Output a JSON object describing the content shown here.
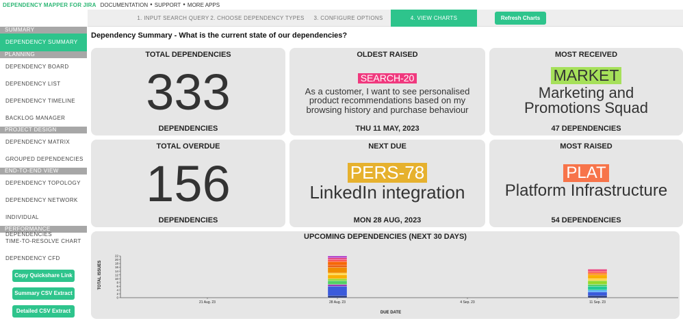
{
  "topbar": {
    "brand": "DEPENDENCY MAPPER FOR JIRA",
    "links": [
      "DOCUMENTATION",
      "SUPPORT",
      "MORE APPS"
    ]
  },
  "steps": [
    {
      "label": "1. INPUT SEARCH QUERY",
      "active": false
    },
    {
      "label": "2. CHOOSE DEPENDENCY TYPES",
      "active": false
    },
    {
      "label": "3. CONFIGURE OPTIONS",
      "active": false
    },
    {
      "label": "4. VIEW CHARTS",
      "active": true
    }
  ],
  "refresh_label": "Refresh Charts",
  "sidebar": {
    "sections": [
      {
        "title": "SUMMARY",
        "items": [
          "DEPENDENCY SUMMARY"
        ]
      },
      {
        "title": "PLANNING",
        "items": [
          "DEPENDENCY BOARD",
          "DEPENDENCY LIST",
          "DEPENDENCY TIMELINE",
          "BACKLOG MANAGER"
        ]
      },
      {
        "title": "PROJECT DESIGN",
        "items": [
          "DEPENDENCY MATRIX",
          "GROUPED DEPENDENCIES"
        ]
      },
      {
        "title": "END-TO-END VIEW",
        "items": [
          "DEPENDENCY TOPOLOGY",
          "DEPENDENCY NETWORK",
          "INDIVIDUAL DEPENDENCIES"
        ]
      },
      {
        "title": "PERFORMANCE",
        "items": [
          "TIME-TO-RESOLVE CHART",
          "DEPENDENCY CFD"
        ]
      }
    ],
    "active_item": "DEPENDENCY SUMMARY",
    "buttons": [
      "Copy Quickshare Link",
      "Summary CSV Extract",
      "Detailed CSV Extract"
    ]
  },
  "heading": "Dependency Summary - What is the current state of our dependencies?",
  "cards": {
    "total": {
      "title": "TOTAL DEPENDENCIES",
      "value": "333",
      "foot": "DEPENDENCIES"
    },
    "oldest": {
      "title": "OLDEST RAISED",
      "key": "SEARCH-20",
      "key_color": "#f0397e",
      "text": "As a customer, I want to see personalised product recommendations based on my browsing history and purchase behaviour",
      "foot": "THU 11 MAY, 2023"
    },
    "received": {
      "title": "MOST RECEIVED",
      "key": "MARKET",
      "key_color": "#a6e05a",
      "text": "Marketing and Promotions Squad",
      "foot": "47 DEPENDENCIES"
    },
    "overdue": {
      "title": "TOTAL OVERDUE",
      "value": "156",
      "foot": "DEPENDENCIES"
    },
    "next": {
      "title": "NEXT DUE",
      "key": "PERS-78",
      "key_color": "#e6b12e",
      "text": "LinkedIn integration",
      "foot": "MON 28 AUG, 2023"
    },
    "raised": {
      "title": "MOST RAISED",
      "key": "PLAT",
      "key_color": "#f7744a",
      "text": "Platform Infrastructure",
      "foot": "54 DEPENDENCIES"
    }
  },
  "chart_data": {
    "type": "bar",
    "title": "UPCOMING DEPENDENCIES (NEXT 30 DAYS)",
    "xlabel": "DUE DATE",
    "ylabel": "TOTAL ISSUES",
    "ylim": [
      0,
      22
    ],
    "yticks": [
      0,
      2,
      4,
      6,
      8,
      10,
      12,
      14,
      16,
      18,
      20,
      22
    ],
    "xticks": [
      "21 Aug. 23",
      "28 Aug. 23",
      "4 Sep. 23",
      "11 Sep. 23"
    ],
    "bars": [
      {
        "date": "28 Aug. 23",
        "total": 22,
        "segments": [
          {
            "value": 1,
            "color": "#1a2a6c"
          },
          {
            "value": 5,
            "color": "#3b5bdb"
          },
          {
            "value": 1,
            "color": "#9c36b5"
          },
          {
            "value": 2,
            "color": "#51cf66"
          },
          {
            "value": 1,
            "color": "#94d82d"
          },
          {
            "value": 2,
            "color": "#fab005"
          },
          {
            "value": 1,
            "color": "#ffd43b"
          },
          {
            "value": 3,
            "color": "#f08c00"
          },
          {
            "value": 1,
            "color": "#e8590c"
          },
          {
            "value": 2,
            "color": "#f76707"
          },
          {
            "value": 1,
            "color": "#fa5252"
          },
          {
            "value": 1,
            "color": "#e64980"
          },
          {
            "value": 1,
            "color": "#ae3ec9"
          }
        ]
      },
      {
        "date": "11 Sep. 23",
        "total": 15,
        "segments": [
          {
            "value": 1,
            "color": "#1a2a6c"
          },
          {
            "value": 2,
            "color": "#3b5bdb"
          },
          {
            "value": 1,
            "color": "#4dabf7"
          },
          {
            "value": 2,
            "color": "#20c997"
          },
          {
            "value": 1,
            "color": "#51cf66"
          },
          {
            "value": 2,
            "color": "#94d82d"
          },
          {
            "value": 1,
            "color": "#ffd43b"
          },
          {
            "value": 2,
            "color": "#fab005"
          },
          {
            "value": 1,
            "color": "#fd7e14"
          },
          {
            "value": 1,
            "color": "#fa5252"
          },
          {
            "value": 1,
            "color": "#e64980"
          }
        ]
      }
    ]
  }
}
